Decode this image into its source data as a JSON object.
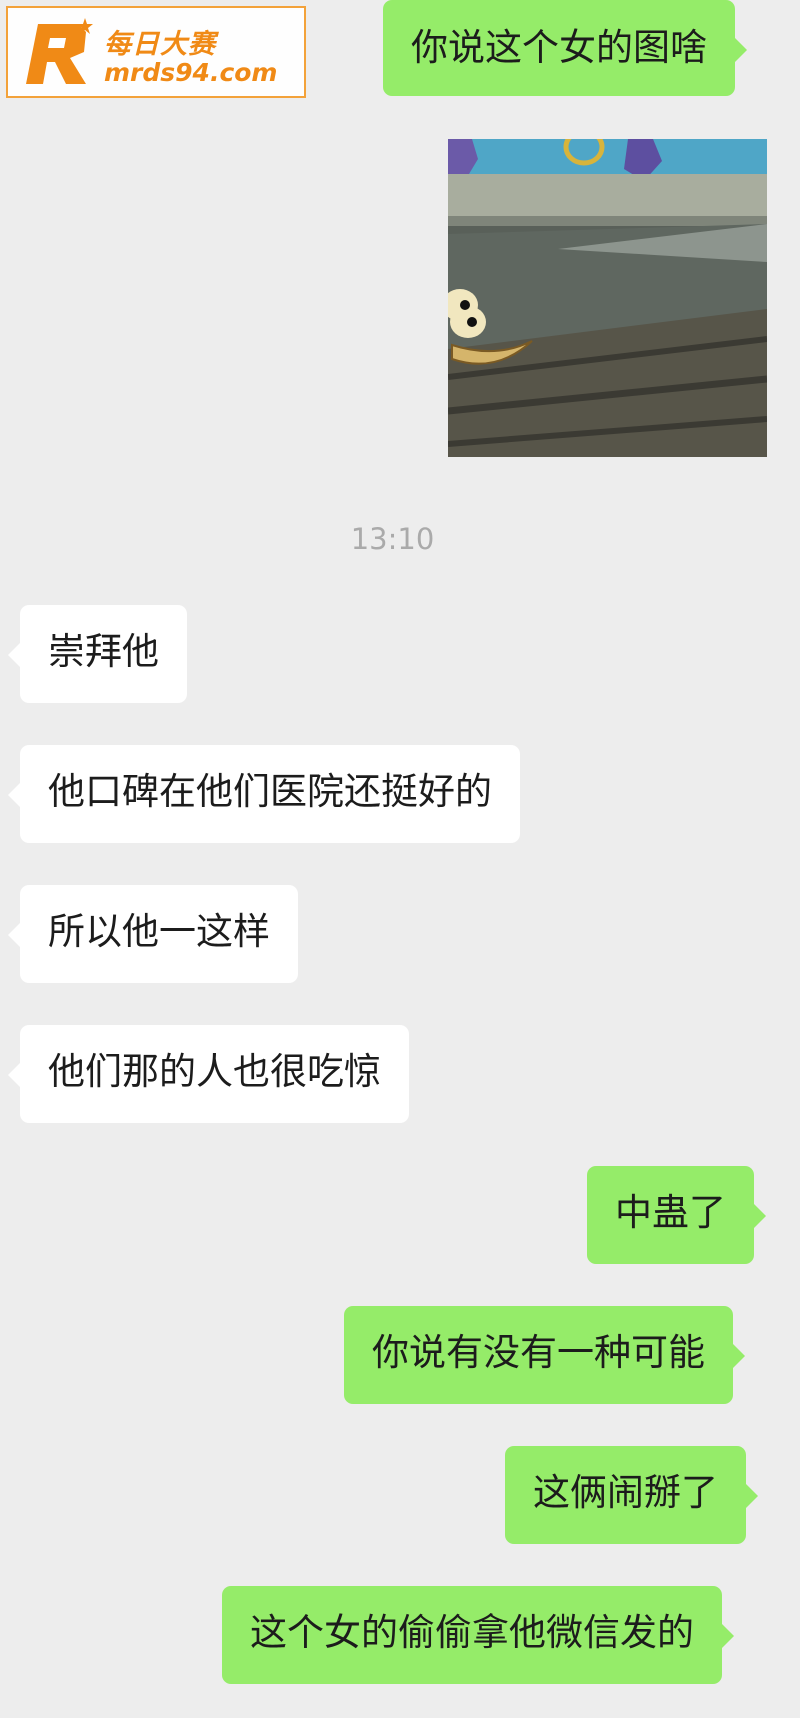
{
  "watermark": {
    "logo_letter": "R",
    "title": "每日大赛",
    "url": "mrds94.com"
  },
  "messages": {
    "m1": "你说这个女的图啥",
    "m2": "崇拜他",
    "m3": "他口碑在他们医院还挺好的",
    "m4": "所以他一这样",
    "m5": "他们那的人也很吃惊",
    "m6": "中蛊了",
    "m7": "你说有没有一种可能",
    "m8": "这俩闹掰了",
    "m9": "这个女的偷偷拿他微信发的"
  },
  "timestamp": "13:10",
  "colors": {
    "background": "#ededed",
    "outgoing_bubble": "#95ec69",
    "incoming_bubble": "#ffffff",
    "watermark": "#f08a16"
  }
}
